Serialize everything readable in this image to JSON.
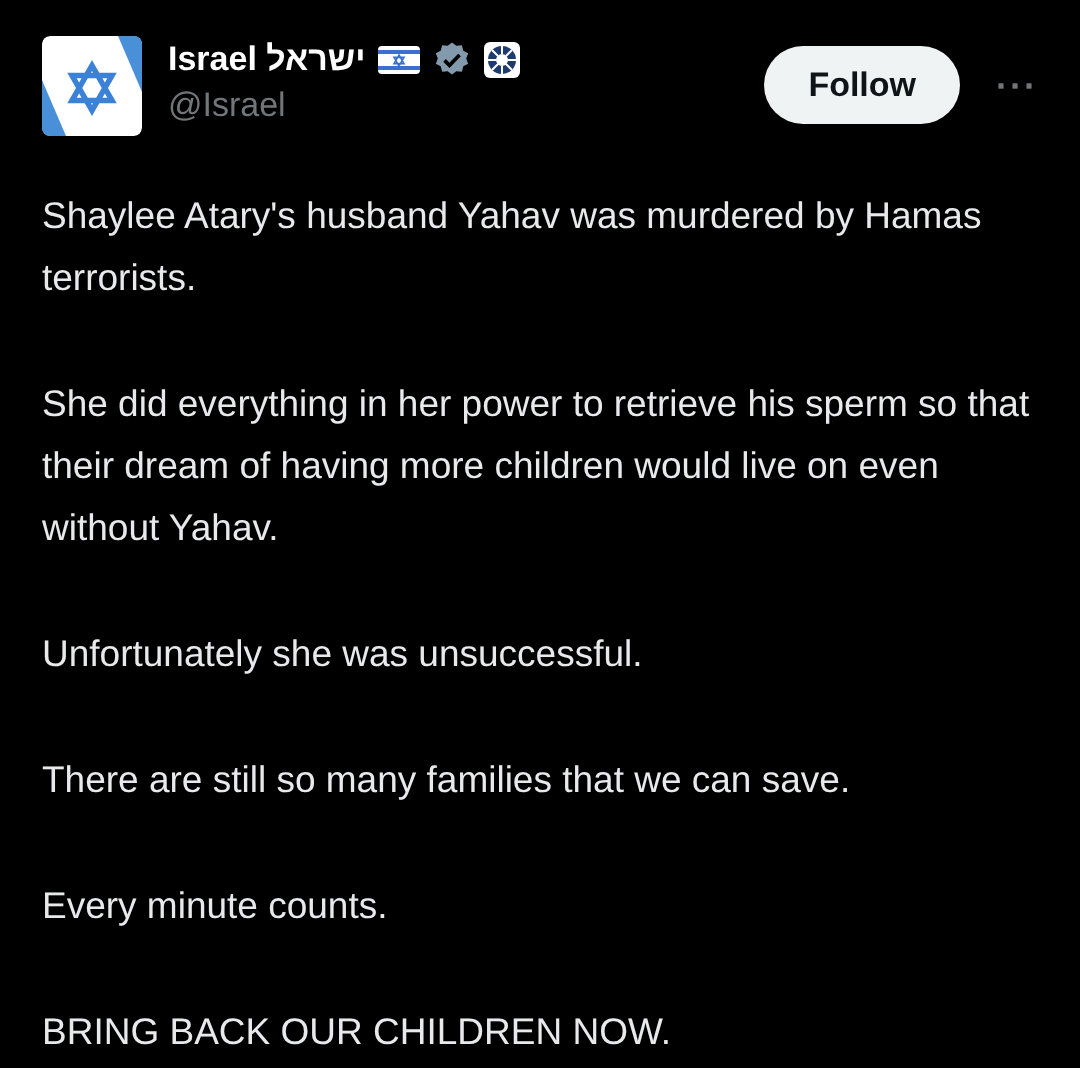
{
  "author": {
    "name": "Israel ישראל",
    "handle": "@Israel",
    "verified": true
  },
  "follow_button": {
    "label": "Follow"
  },
  "more_button": {
    "label": "···"
  },
  "paragraphs": [
    "Shaylee Atary's husband Yahav was murdered by Hamas terrorists.",
    "She did everything in her power to retrieve his sperm so that their dream of having more children would live on even without Yahav.",
    "Unfortunately she was unsuccessful.",
    "There are still so many families that we can save.",
    "Every minute counts.",
    "BRING BACK OUR CHILDREN NOW."
  ]
}
